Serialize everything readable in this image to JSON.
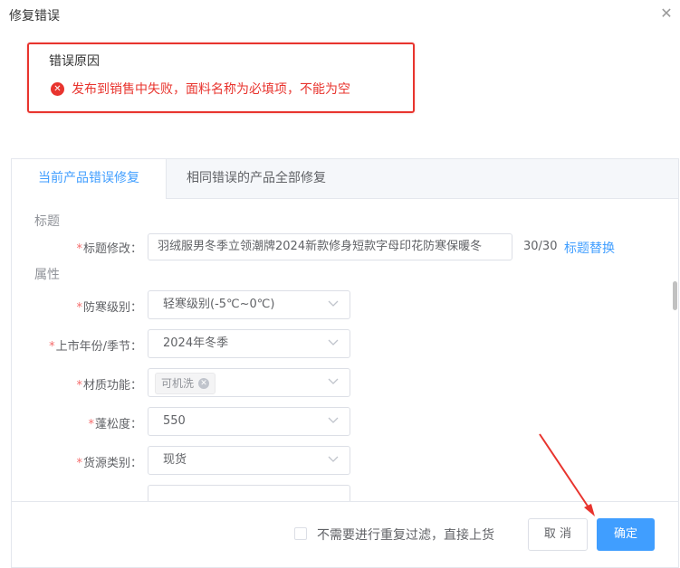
{
  "dialog": {
    "title": "修复错误"
  },
  "error": {
    "heading": "错误原因",
    "message": "发布到销售中失败，面料名称为必填项，不能为空",
    "color": "#e8342e"
  },
  "tabs": [
    {
      "label": "当前产品错误修复",
      "active": true
    },
    {
      "label": "相同错误的产品全部修复",
      "active": false
    }
  ],
  "sections": {
    "title_section": "标题",
    "attr_section": "属性"
  },
  "title_field": {
    "label": "标题修改：",
    "value": "羽绒服男冬季立领潮牌2024新款修身短款字母印花防寒保暖冬",
    "count": "30/30",
    "replace_link": "标题替换"
  },
  "attributes": [
    {
      "label": "防寒级别：",
      "value": "轻寒级别(-5℃~0℃)"
    },
    {
      "label": "上市年份/季节：",
      "value": "2024年冬季"
    },
    {
      "label": "材质功能：",
      "tag": "可机洗"
    },
    {
      "label": "蓬松度：",
      "value": "550"
    },
    {
      "label": "货源类别：",
      "value": "现货"
    }
  ],
  "footer": {
    "checkbox_label": "不需要进行重复过滤，直接上货",
    "cancel_label": "取 消",
    "ok_label": "确定"
  },
  "accent_color": "#409eff"
}
